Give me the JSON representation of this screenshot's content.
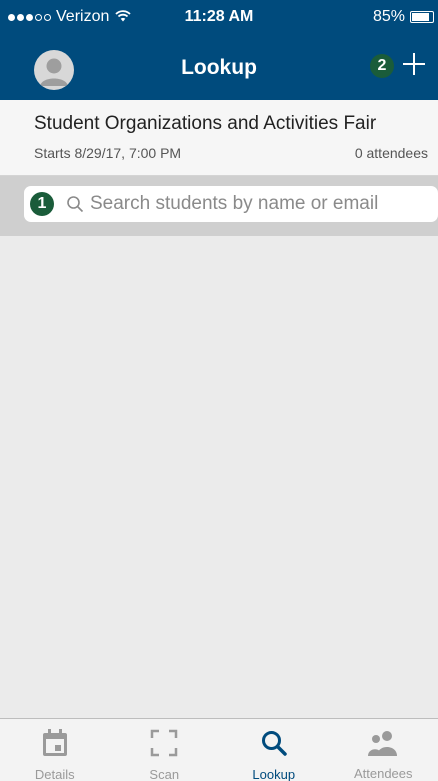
{
  "status_bar": {
    "carrier": "Verizon",
    "time": "11:28 AM",
    "battery_percent_label": "85%",
    "battery_level": 0.85,
    "signal_bars_filled": 3,
    "signal_bars_total": 5
  },
  "nav": {
    "title": "Lookup",
    "badge_add": "2",
    "icons": {
      "avatar": "avatar-icon",
      "add": "plus-icon"
    }
  },
  "event": {
    "title": "Student Organizations and Activities Fair",
    "starts": "Starts 8/29/17, 7:00 PM",
    "attendees": "0 attendees"
  },
  "search": {
    "badge": "1",
    "placeholder": "Search students by name or email",
    "value": ""
  },
  "tabs": [
    {
      "label": "Details",
      "icon": "calendar-icon",
      "active": false
    },
    {
      "label": "Scan",
      "icon": "scan-frame-icon",
      "active": false
    },
    {
      "label": "Lookup",
      "icon": "search-icon",
      "active": true
    },
    {
      "label": "Attendees",
      "icon": "people-icon",
      "active": false
    }
  ],
  "colors": {
    "brand": "#004b7d",
    "badge": "#1a5c3a",
    "background": "#ebebeb",
    "tab_inactive": "#9a9a9a"
  }
}
